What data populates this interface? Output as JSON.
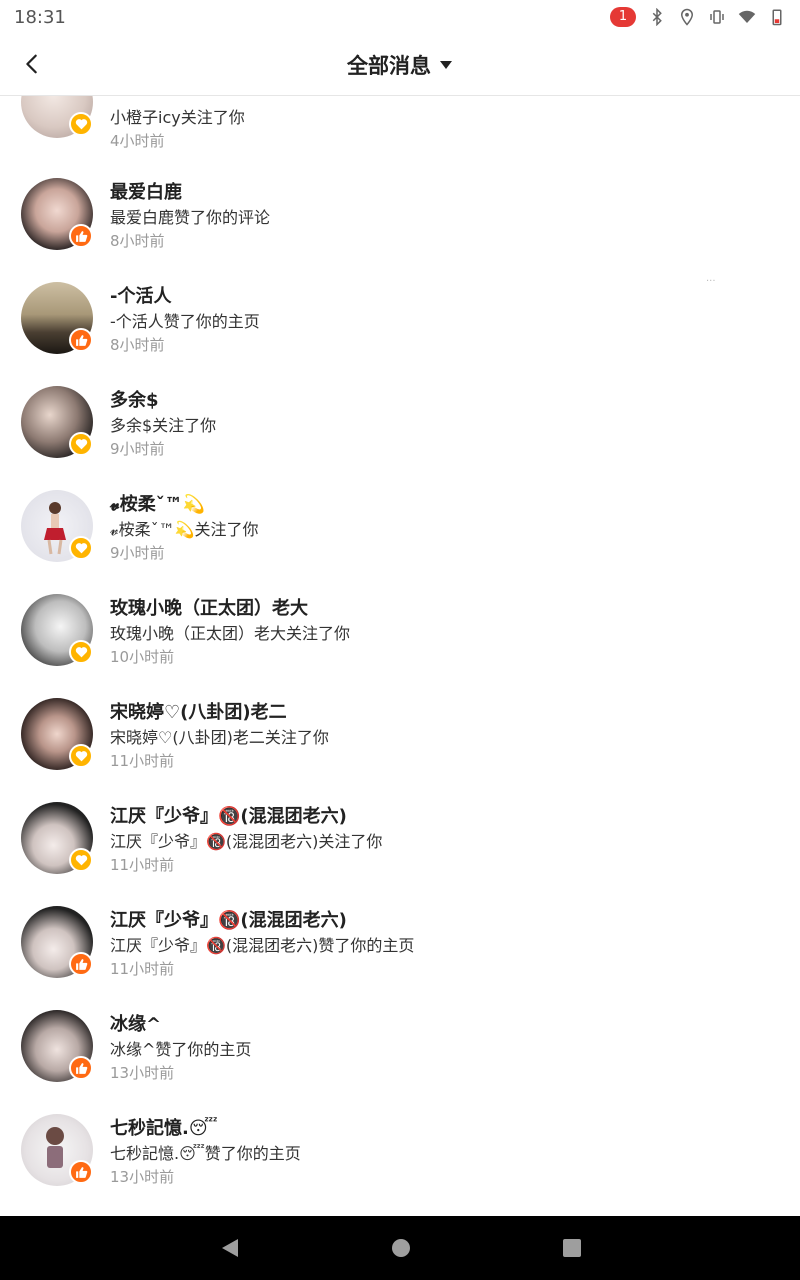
{
  "status_bar": {
    "time": "18:31",
    "notification_count": "1"
  },
  "header": {
    "title": "全部消息",
    "dropdown_icon": "caret-down-icon",
    "back_icon": "chevron-left-icon"
  },
  "colors": {
    "like_badge": "#ff6a13",
    "follow_badge": "#ffb400"
  },
  "messages": [
    {
      "name": "",
      "desc": "小橙子icy关注了你",
      "time": "4小时前",
      "type": "follow"
    },
    {
      "name": "最爱白鹿",
      "desc": "最爱白鹿赞了你的评论",
      "time": "8小时前",
      "type": "like"
    },
    {
      "name": "-个活人",
      "desc": "-个活人赞了你的主页",
      "time": "8小时前",
      "type": "like"
    },
    {
      "name": "多余$",
      "desc": "多余$关注了你",
      "time": "9小时前",
      "type": "follow"
    },
    {
      "name": "𝓿桉柔ˇ™💫",
      "desc": "𝓿桉柔ˇ™💫关注了你",
      "time": "9小时前",
      "type": "follow"
    },
    {
      "name": "玫瑰小晚（正太团）老大",
      "desc": "玫瑰小晚（正太团）老大关注了你",
      "time": "10小时前",
      "type": "follow"
    },
    {
      "name": "宋晓婷♡(八卦团)老二",
      "desc": "宋晓婷♡(八卦团)老二关注了你",
      "time": "11小时前",
      "type": "follow"
    },
    {
      "name": "江厌『少爷』🔞(混混团老六)",
      "desc": "江厌『少爷』🔞(混混团老六)关注了你",
      "time": "11小时前",
      "type": "follow"
    },
    {
      "name": "江厌『少爷』🔞(混混团老六)",
      "desc": "江厌『少爷』🔞(混混团老六)赞了你的主页",
      "time": "11小时前",
      "type": "like"
    },
    {
      "name": "冰缘^",
      "desc": "冰缘^赞了你的主页",
      "time": "13小时前",
      "type": "like"
    },
    {
      "name": "七秒記憶.😴",
      "desc": "七秒記憶.😴赞了你的主页",
      "time": "13小时前",
      "type": "like"
    }
  ]
}
